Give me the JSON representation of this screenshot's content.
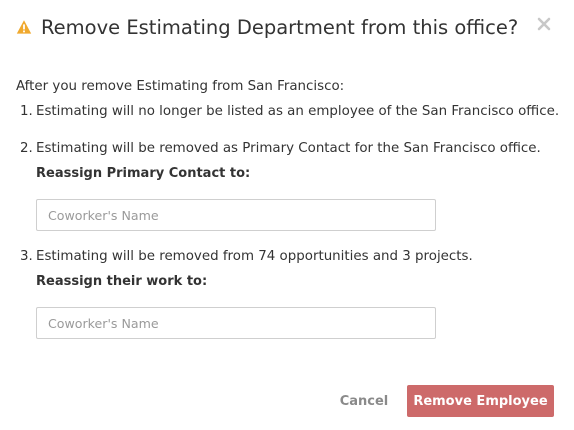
{
  "dialog": {
    "title": "Remove Estimating Department from this office?",
    "warning_color": "#f0a92e",
    "intro": "After you remove Estimating from San Francisco:",
    "items": [
      {
        "number": "1.",
        "text": "Estimating will no longer be listed as an employee of the San Francisco office."
      },
      {
        "number": "2.",
        "text": "Estimating will be removed as Primary Contact for the San Francisco office.",
        "reassign_label": "Reassign Primary Contact to:",
        "input_placeholder": "Coworker's Name",
        "input_value": ""
      },
      {
        "number": "3.",
        "text": "Estimating will be removed from 74 opportunities and 3 projects.",
        "reassign_label": "Reassign their work to:",
        "input_placeholder": "Coworker's Name",
        "input_value": ""
      }
    ]
  },
  "footer": {
    "cancel_label": "Cancel",
    "remove_label": "Remove Employee",
    "remove_color": "#cd6a6a"
  }
}
